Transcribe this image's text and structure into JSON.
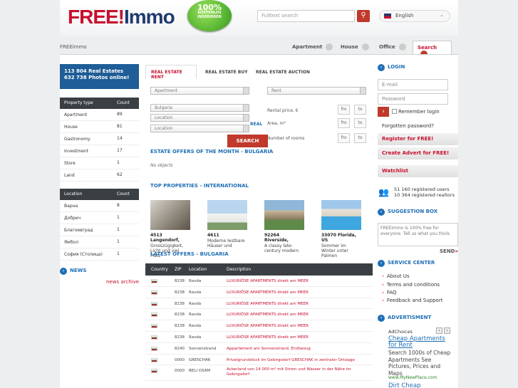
{
  "header": {
    "logo_part1": "FREE!",
    "logo_part2": "Immo",
    "badge_line1": "100%",
    "badge_line2": "KOSTENLOS",
    "badge_line3": "INSERIEREN",
    "search_placeholder": "Fulltext search",
    "language": "English"
  },
  "breadcrumb": "FREEimmo",
  "nav": {
    "tabs": [
      "Apartment",
      "House",
      "Office"
    ],
    "active_tab": "Search"
  },
  "stats": {
    "line1": "113 804  Real Estates",
    "line2": "632 738  Photos online!"
  },
  "property_types": {
    "header_label": "Property type",
    "header_count": "Count",
    "rows": [
      {
        "label": "Apartment",
        "count": "89"
      },
      {
        "label": "House",
        "count": "81"
      },
      {
        "label": "Gastronomy",
        "count": "14"
      },
      {
        "label": "Investment",
        "count": "17"
      },
      {
        "label": "Store",
        "count": "1"
      },
      {
        "label": "Land",
        "count": "62"
      }
    ]
  },
  "locations": {
    "header_label": "Location",
    "header_count": "Count",
    "rows": [
      {
        "label": "Варна",
        "count": "8"
      },
      {
        "label": "Добрич",
        "count": "1"
      },
      {
        "label": "Благоевград",
        "count": "1"
      },
      {
        "label": "Ямбол",
        "count": "1"
      },
      {
        "label": "София (Столица)",
        "count": "1"
      }
    ]
  },
  "news": {
    "title": "NEWS",
    "archive": "news archive"
  },
  "search_tabs": [
    "REAL ESTATE RENT",
    "REAL ESTATE BUY",
    "REAL ESTATE AUCTION"
  ],
  "search_form": {
    "type": "Apartment",
    "mode": "Rent",
    "country": "Bulgaria",
    "location1": "Location",
    "location2": "Location",
    "rental_price": "Rental price, €",
    "area": "Area, m²",
    "rooms": "Number of rooms",
    "from": "fro",
    "to": "to",
    "submit": "SEARCH",
    "real_tag": "REAL"
  },
  "month_offers": {
    "title": "ESTATE OFFERS OF THE MONTH - BULGARIA",
    "empty": "No objects"
  },
  "top_properties": {
    "title": "TOP PROPERTIES - INTERNATIONAL",
    "items": [
      {
        "title": "4513 Langendorf,",
        "desc": "Grosszügigkeit, Licht und viel Platz"
      },
      {
        "title": "4611",
        "desc": "Moderne lestbare Häuser und"
      },
      {
        "title": "92264 Riverside,",
        "desc": "A classy late-century modern"
      },
      {
        "title": "33070 Florida, US",
        "desc": "Sommer im Winter unter Palmen"
      }
    ]
  },
  "latest_offers": {
    "title": "LATEST OFFERS - BULGARIA",
    "headers": [
      "Country",
      "ZIP",
      "Location",
      "Description"
    ],
    "rows": [
      {
        "zip": "8238",
        "location": "Ravda",
        "desc": "LUXURIÖSE APARTMENTS direkt am MEER"
      },
      {
        "zip": "8238",
        "location": "Ravda",
        "desc": "LUXURIÖSE APARTMENTS direkt am MEER"
      },
      {
        "zip": "8238",
        "location": "Ravda",
        "desc": "LUXURIÖSE APARTMENTS direkt am MEER"
      },
      {
        "zip": "8238",
        "location": "Ravda",
        "desc": "LUXURIÖSE APARTMENTS direkt am MEER"
      },
      {
        "zip": "8238",
        "location": "Ravda",
        "desc": "LUXURIÖSE APARTMENTS direkt am MEER"
      },
      {
        "zip": "8238",
        "location": "Ravda",
        "desc": "LUXURIÖSE APARTMENTS direkt am MEER"
      },
      {
        "zip": "8240",
        "location": "Sonnenstrand",
        "desc": "Appartement am Sonnenstrand, Erstbezug"
      },
      {
        "zip": "0000",
        "location": "GRESCHAK",
        "desc": "Privatgrundstück im Gebirgsdorf GRESCHAK in zentraler Ortslage"
      },
      {
        "zip": "0000",
        "location": "BELI OSAM",
        "desc": "Ackerland von 14 000 m² mit Strom und Wasser in der Nähe im Gebirgsdorf"
      }
    ]
  },
  "login": {
    "title": "LOGIN",
    "email_placeholder": "E-mail",
    "password_placeholder": "Password",
    "remember": "Remember login",
    "forgot": "Forgotten password?",
    "register": "Register for FREE!",
    "create_advert": "Create Advert for FREE!",
    "watchlist": "Watchlist"
  },
  "users": {
    "line1": "51 160  registered users",
    "line2": "10 364  registered realtors"
  },
  "suggestion": {
    "title": "SUGGESTION BOX",
    "text": "FREEimmo is 100% free for everyone. Tell us what you think.",
    "send": "SEND"
  },
  "service": {
    "title": "SERVICE CENTER",
    "links": [
      "About Us",
      "Terms and conditions",
      "FAQ",
      "Feedback and Support"
    ]
  },
  "ad": {
    "title": "ADVERTISMENT",
    "choices": "AdChoices",
    "headline": "Cheap Apartments for Rent",
    "body": "Search 1000s of Cheap Apartments See Pictures, Prices and Maps",
    "url": "www.MyNewPlace.com",
    "next": "Dirt Cheap"
  }
}
